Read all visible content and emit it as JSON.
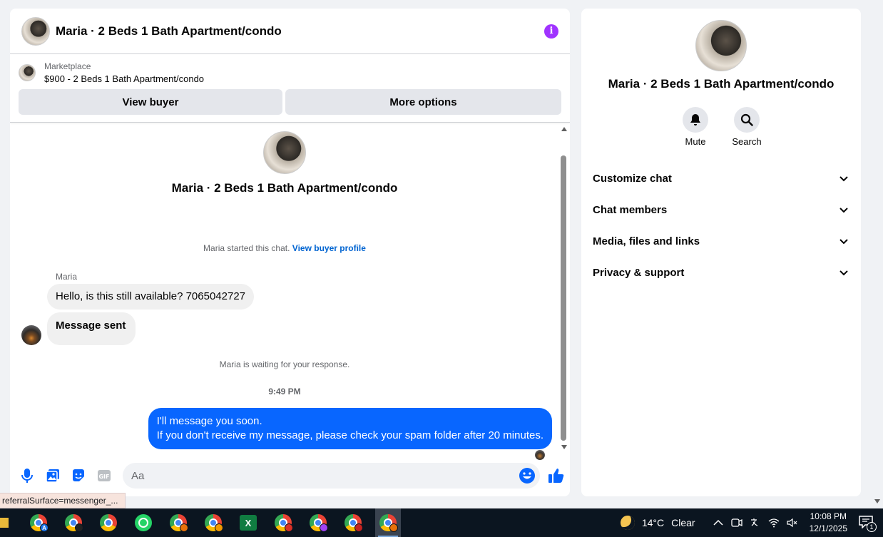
{
  "chat": {
    "header_title": "Maria · 2 Beds 1 Bath Apartment/condo",
    "listing": {
      "label": "Marketplace",
      "title": "$900 - 2 Beds 1 Bath Apartment/condo"
    },
    "buttons": {
      "view_buyer": "View buyer",
      "more_options": "More options"
    },
    "intro_title": "Maria · 2 Beds 1 Bath Apartment/condo",
    "started_text": "Maria started this chat.",
    "started_link": "View buyer profile",
    "sender_name": "Maria",
    "incoming": [
      "Hello, is this still available? 7065042727",
      "Message sent"
    ],
    "waiting_text": "Maria is waiting for your response.",
    "timestamp": "9:49 PM",
    "outgoing_lines": [
      "I'll message you soon.",
      "If you don't receive my message, please check your spam folder after 20 minutes."
    ],
    "composer_placeholder": "Aa",
    "colors": {
      "accent": "#0866ff",
      "info": "#a033ff"
    }
  },
  "side": {
    "title": "Maria · 2 Beds 1 Bath Apartment/condo",
    "actions": {
      "mute": "Mute",
      "search": "Search"
    },
    "menu": [
      "Customize chat",
      "Chat members",
      "Media, files and links",
      "Privacy & support"
    ]
  },
  "status_url": "referralSurface=messenger_...",
  "taskbar": {
    "temperature": "14°C",
    "condition": "Clear",
    "time": "10:08 PM",
    "date": "12/1/2025",
    "notification_count": "1",
    "badges": [
      "A",
      "",
      "",
      "",
      "",
      "",
      "",
      "",
      ""
    ]
  }
}
